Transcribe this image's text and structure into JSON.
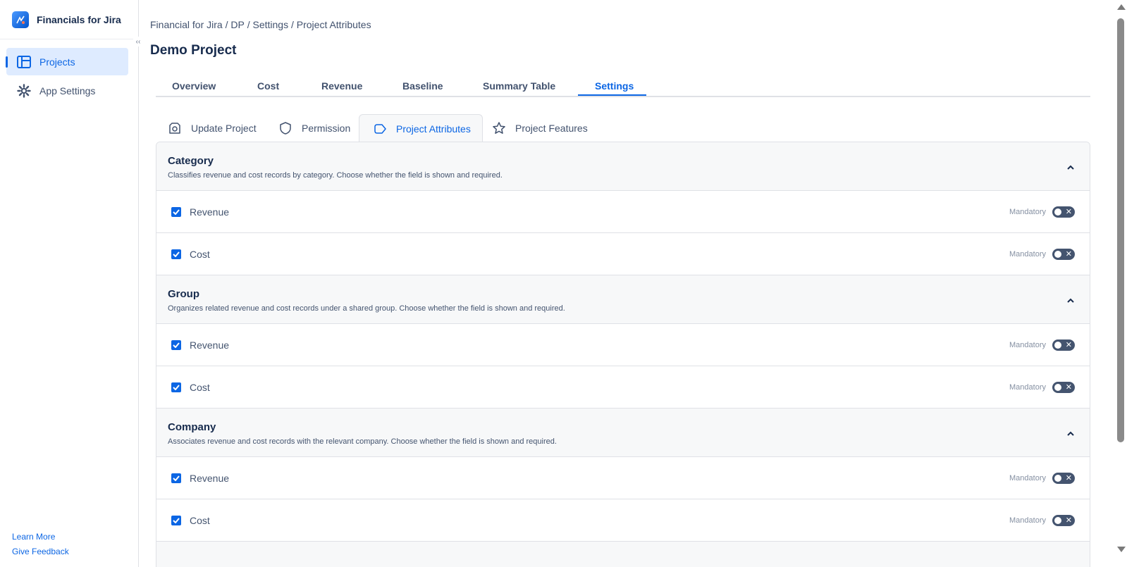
{
  "sidebar": {
    "app_title": "Financials for Jira",
    "items": [
      {
        "label": "Projects",
        "icon": "board-icon",
        "active": true
      },
      {
        "label": "App Settings",
        "icon": "gear-icon",
        "active": false
      }
    ],
    "learn_more": "Learn More",
    "give_feedback": "Give Feedback"
  },
  "breadcrumb": {
    "items": [
      "Financial for Jira",
      " / DP",
      " / Settings",
      " / Project Attributes"
    ]
  },
  "page": {
    "title": "Demo Project"
  },
  "tabs": [
    {
      "label": "Overview"
    },
    {
      "label": "Cost"
    },
    {
      "label": "Revenue"
    },
    {
      "label": "Baseline"
    },
    {
      "label": "Summary Table"
    },
    {
      "label": "Settings",
      "active": true
    }
  ],
  "subtabs": [
    {
      "label": "Update Project",
      "icon": "update-icon"
    },
    {
      "label": "Permission",
      "icon": "shield-icon"
    },
    {
      "label": "Project Attributes",
      "icon": "tag-icon",
      "active": true
    },
    {
      "label": "Project Features",
      "icon": "star-icon"
    }
  ],
  "sections": [
    {
      "title": "Category",
      "description": "Classifies revenue and cost records by category. Choose whether the field is shown and required.",
      "rows": [
        {
          "label": "Revenue",
          "checked": true,
          "mandatory_label": "Mandatory",
          "mandatory": false
        },
        {
          "label": "Cost",
          "checked": true,
          "mandatory_label": "Mandatory",
          "mandatory": false
        }
      ]
    },
    {
      "title": "Group",
      "description": "Organizes related revenue and cost records under a shared group. Choose whether the field is shown and required.",
      "rows": [
        {
          "label": "Revenue",
          "checked": true,
          "mandatory_label": "Mandatory",
          "mandatory": false
        },
        {
          "label": "Cost",
          "checked": true,
          "mandatory_label": "Mandatory",
          "mandatory": false
        }
      ]
    },
    {
      "title": "Company",
      "description": "Associates revenue and cost records with the relevant company. Choose whether the field is shown and required.",
      "rows": [
        {
          "label": "Revenue",
          "checked": true,
          "mandatory_label": "Mandatory",
          "mandatory": false
        },
        {
          "label": "Cost",
          "checked": true,
          "mandatory_label": "Mandatory",
          "mandatory": false
        }
      ]
    }
  ],
  "colors": {
    "accent": "#0c66e4",
    "active_bg": "#deebff",
    "toggle_off": "#44546f"
  }
}
